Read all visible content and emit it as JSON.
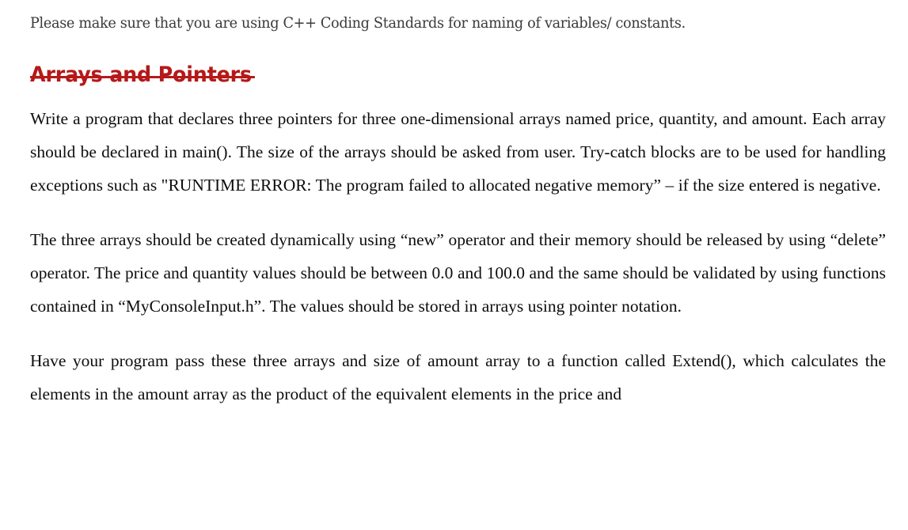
{
  "document": {
    "background_color": "#FFFFFF",
    "text_color": "#0D0D0D",
    "accent_color": "#B51919",
    "note": "Please make sure that you are using C++ Coding Standards for naming of variables/ constants.",
    "heading": "Arrays and Pointers",
    "paragraphs": [
      "Write a program that declares three pointers for three one-dimensional arrays named price, quantity, and amount. Each array should be declared in main(). The size of the arrays should be asked from user. Try-catch blocks are to be used for handling exceptions such as \"RUNTIME ERROR: The program failed to allocated negative memory” – if the size entered is negative.",
      "The three arrays should be created dynamically using “new” operator and their memory should be released by using “delete” operator. The price and quantity values should be between 0.0 and 100.0 and the same should be validated by using functions contained in “MyConsoleInput.h”. The values should be stored in arrays using pointer notation.",
      "Have your program pass these three arrays and size of amount array to a function called Extend(), which calculates the elements in the amount array as the product of the equivalent elements in the price and"
    ]
  }
}
